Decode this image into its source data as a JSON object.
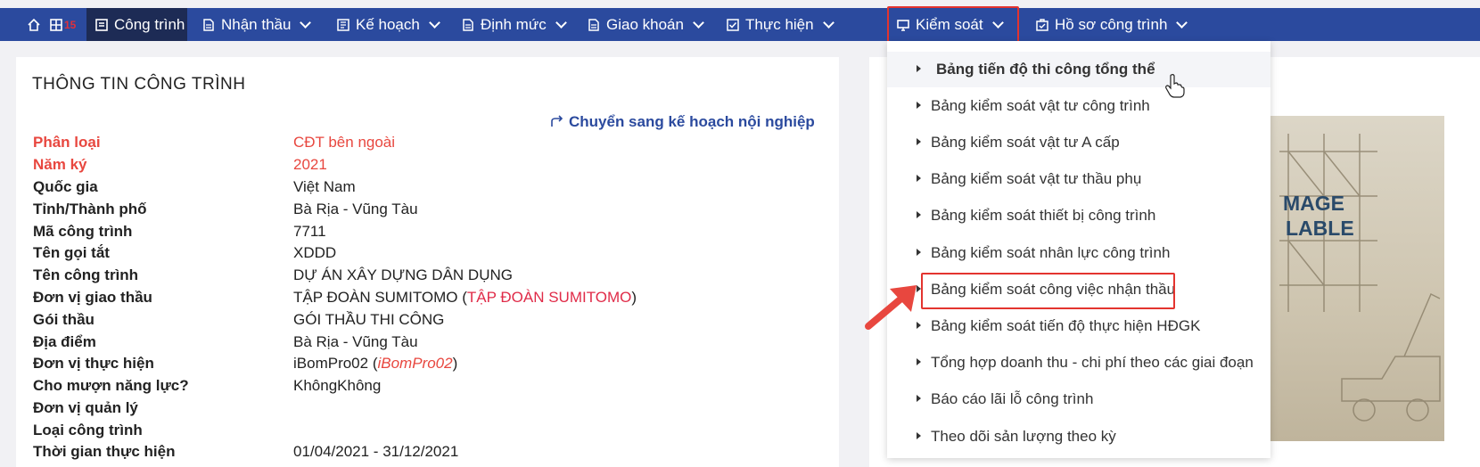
{
  "nav": {
    "home_icon": "home-icon",
    "grid_icon": "grid-icon",
    "badge": "15",
    "items": [
      {
        "label": "Công trình"
      },
      {
        "label": "Nhận thầu"
      },
      {
        "label": "Kế hoạch"
      },
      {
        "label": "Định mức"
      },
      {
        "label": "Giao khoán"
      },
      {
        "label": "Thực hiện"
      },
      {
        "label": "Kiểm soát"
      },
      {
        "label": "Hồ sơ công trình"
      }
    ]
  },
  "info": {
    "title": "THÔNG TIN CÔNG TRÌNH",
    "convert_link": "Chuyển sang kế hoạch nội nghiệp",
    "rows": [
      {
        "label": "Phân loại",
        "value": "CĐT bên ngoài"
      },
      {
        "label": "Năm ký",
        "value": "2021"
      },
      {
        "label": "Quốc gia",
        "value": "Việt Nam"
      },
      {
        "label": "Tỉnh/Thành phố",
        "value": "Bà Rịa - Vũng Tàu"
      },
      {
        "label": "Mã công trình",
        "value": "7711"
      },
      {
        "label": "Tên gọi tắt",
        "value": "XDDD"
      },
      {
        "label": "Tên công trình",
        "value": "DỰ ÁN XÂY DỰNG DÂN DỤNG"
      },
      {
        "label": "Đơn vị giao thầu",
        "value": "TẬP ĐOÀN SUMITOMO (",
        "extra": "TẬP ĐOÀN SUMITOMO",
        "suffix": ")"
      },
      {
        "label": "Gói thầu",
        "value": "GÓI THẦU THI CÔNG"
      },
      {
        "label": "Địa điểm",
        "value": "Bà Rịa - Vũng Tàu"
      },
      {
        "label": "Đơn vị thực hiện",
        "value": "iBomPro02 (",
        "extra": "iBomPro02",
        "suffix": ")"
      },
      {
        "label": "Cho mượn năng lực?",
        "value": "KhôngKhông"
      },
      {
        "label": "Đơn vị quản lý",
        "value": ""
      },
      {
        "label": "Loại công trình",
        "value": ""
      },
      {
        "label": "Thời gian thực hiện",
        "value": "01/04/2021 - 31/12/2021"
      }
    ]
  },
  "dropdown": {
    "items": [
      {
        "label": "Bảng tiến độ thi công tổng thể"
      },
      {
        "label": "Bảng kiểm soát vật tư công trình"
      },
      {
        "label": "Bảng kiểm soát vật tư A cấp"
      },
      {
        "label": "Bảng kiểm soát vật tư thầu phụ"
      },
      {
        "label": "Bảng kiểm soát thiết bị công trình"
      },
      {
        "label": "Bảng kiểm soát nhân lực công trình"
      },
      {
        "label": "Bảng kiểm soát công việc nhận thầu"
      },
      {
        "label": "Bảng kiểm soát tiến độ thực hiện HĐGK"
      },
      {
        "label": "Tổng hợp doanh thu - chi phí theo các giai đoạn"
      },
      {
        "label": "Báo cáo lãi lỗ công trình"
      },
      {
        "label": "Theo dõi sản lượng theo kỳ"
      }
    ]
  },
  "side_image": {
    "line1": "MAGE",
    "line2": "LABLE"
  },
  "colors": {
    "nav_bg": "#2b4a9e",
    "active_bg": "#1d2b55",
    "highlight": "#e3342f",
    "accent_red": "#e8473f"
  }
}
